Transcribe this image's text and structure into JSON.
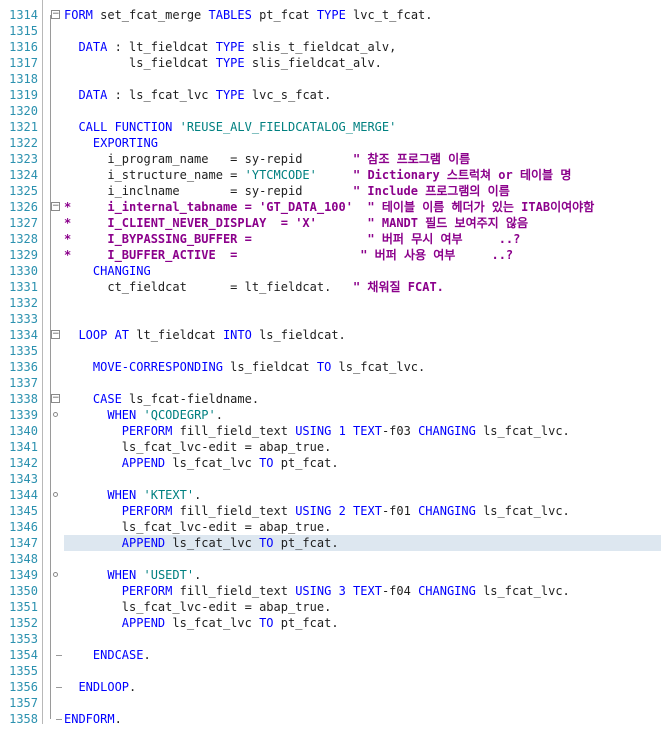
{
  "editor": {
    "highlighted_line": 1347,
    "lines": [
      {
        "no": "1314",
        "tokens": [
          [
            "kw",
            "FORM"
          ],
          [
            "id",
            " set_fcat_merge "
          ],
          [
            "kw",
            "TABLES"
          ],
          [
            "id",
            " pt_fcat "
          ],
          [
            "kw",
            "TYPE"
          ],
          [
            "id",
            " lvc_t_fcat."
          ]
        ]
      },
      {
        "no": "1315",
        "tokens": []
      },
      {
        "no": "1316",
        "tokens": [
          [
            "id",
            "  "
          ],
          [
            "kw",
            "DATA"
          ],
          [
            "id",
            " : lt_fieldcat "
          ],
          [
            "kw",
            "TYPE"
          ],
          [
            "id",
            " slis_t_fieldcat_alv,"
          ]
        ]
      },
      {
        "no": "1317",
        "tokens": [
          [
            "id",
            "         ls_fieldcat "
          ],
          [
            "kw",
            "TYPE"
          ],
          [
            "id",
            " slis_fieldcat_alv."
          ]
        ]
      },
      {
        "no": "1318",
        "tokens": []
      },
      {
        "no": "1319",
        "tokens": [
          [
            "id",
            "  "
          ],
          [
            "kw",
            "DATA"
          ],
          [
            "id",
            " : ls_fcat_lvc "
          ],
          [
            "kw",
            "TYPE"
          ],
          [
            "id",
            " lvc_s_fcat."
          ]
        ]
      },
      {
        "no": "1320",
        "tokens": []
      },
      {
        "no": "1321",
        "tokens": [
          [
            "id",
            "  "
          ],
          [
            "kw",
            "CALL FUNCTION"
          ],
          [
            "id",
            " "
          ],
          [
            "str",
            "'REUSE_ALV_FIELDCATALOG_MERGE'"
          ]
        ]
      },
      {
        "no": "1322",
        "tokens": [
          [
            "id",
            "    "
          ],
          [
            "kw",
            "EXPORTING"
          ]
        ]
      },
      {
        "no": "1323",
        "tokens": [
          [
            "id",
            "      i_program_name   = sy-repid       "
          ],
          [
            "cm",
            "\" 참조 프로그램 이름"
          ]
        ]
      },
      {
        "no": "1324",
        "tokens": [
          [
            "id",
            "      i_structure_name = "
          ],
          [
            "str",
            "'YTCMCODE'"
          ],
          [
            "id",
            "     "
          ],
          [
            "cm",
            "\" Dictionary 스트럭쳐 or 테이블 명"
          ]
        ]
      },
      {
        "no": "1325",
        "tokens": [
          [
            "id",
            "      i_inclname       = sy-repid       "
          ],
          [
            "cm",
            "\" Include 프로그램의 이름"
          ]
        ]
      },
      {
        "no": "1326",
        "tokens": [
          [
            "star",
            "*     i_internal_tabname = 'GT_DATA_100'  \" 테이블 이름 헤더가 있는 ITAB이여야함"
          ]
        ]
      },
      {
        "no": "1327",
        "tokens": [
          [
            "star",
            "*     I_CLIENT_NEVER_DISPLAY  = 'X'       \" MANDT 필드 보여주지 않음"
          ]
        ]
      },
      {
        "no": "1328",
        "tokens": [
          [
            "star",
            "*     I_BYPASSING_BUFFER =                \" 버퍼 무시 여부     ..?"
          ]
        ]
      },
      {
        "no": "1329",
        "tokens": [
          [
            "star",
            "*     I_BUFFER_ACTIVE  =                 \" 버퍼 사용 여부     ..?"
          ]
        ]
      },
      {
        "no": "1330",
        "tokens": [
          [
            "id",
            "    "
          ],
          [
            "kw",
            "CHANGING"
          ]
        ]
      },
      {
        "no": "1331",
        "tokens": [
          [
            "id",
            "      ct_fieldcat      = lt_fieldcat.   "
          ],
          [
            "cm",
            "\" 채워질 FCAT."
          ]
        ]
      },
      {
        "no": "1332",
        "tokens": []
      },
      {
        "no": "1333",
        "tokens": []
      },
      {
        "no": "1334",
        "tokens": [
          [
            "id",
            "  "
          ],
          [
            "kw",
            "LOOP AT"
          ],
          [
            "id",
            " lt_fieldcat "
          ],
          [
            "kw",
            "INTO"
          ],
          [
            "id",
            " ls_fieldcat."
          ]
        ]
      },
      {
        "no": "1335",
        "tokens": []
      },
      {
        "no": "1336",
        "tokens": [
          [
            "id",
            "    "
          ],
          [
            "kw",
            "MOVE-CORRESPONDING"
          ],
          [
            "id",
            " ls_fieldcat "
          ],
          [
            "kw",
            "TO"
          ],
          [
            "id",
            " ls_fcat_lvc."
          ]
        ]
      },
      {
        "no": "1337",
        "tokens": []
      },
      {
        "no": "1338",
        "tokens": [
          [
            "id",
            "    "
          ],
          [
            "kw",
            "CASE"
          ],
          [
            "id",
            " ls_fcat-fieldname."
          ]
        ]
      },
      {
        "no": "1339",
        "tokens": [
          [
            "id",
            "      "
          ],
          [
            "kw",
            "WHEN"
          ],
          [
            "id",
            " "
          ],
          [
            "str",
            "'QCODEGRP'"
          ],
          [
            "id",
            "."
          ]
        ]
      },
      {
        "no": "1340",
        "tokens": [
          [
            "id",
            "        "
          ],
          [
            "kw",
            "PERFORM"
          ],
          [
            "id",
            " fill_field_text "
          ],
          [
            "kw",
            "USING"
          ],
          [
            "id",
            " "
          ],
          [
            "num",
            "1"
          ],
          [
            "id",
            " "
          ],
          [
            "kw",
            "TEXT"
          ],
          [
            "id",
            "-f03 "
          ],
          [
            "kw",
            "CHANGING"
          ],
          [
            "id",
            " ls_fcat_lvc."
          ]
        ]
      },
      {
        "no": "1341",
        "tokens": [
          [
            "id",
            "        ls_fcat_lvc-edit = abap_true."
          ]
        ]
      },
      {
        "no": "1342",
        "tokens": [
          [
            "id",
            "        "
          ],
          [
            "kw",
            "APPEND"
          ],
          [
            "id",
            " ls_fcat_lvc "
          ],
          [
            "kw",
            "TO"
          ],
          [
            "id",
            " pt_fcat."
          ]
        ]
      },
      {
        "no": "1343",
        "tokens": []
      },
      {
        "no": "1344",
        "tokens": [
          [
            "id",
            "      "
          ],
          [
            "kw",
            "WHEN"
          ],
          [
            "id",
            " "
          ],
          [
            "str",
            "'KTEXT'"
          ],
          [
            "id",
            "."
          ]
        ]
      },
      {
        "no": "1345",
        "tokens": [
          [
            "id",
            "        "
          ],
          [
            "kw",
            "PERFORM"
          ],
          [
            "id",
            " fill_field_text "
          ],
          [
            "kw",
            "USING"
          ],
          [
            "id",
            " "
          ],
          [
            "num",
            "2"
          ],
          [
            "id",
            " "
          ],
          [
            "kw",
            "TEXT"
          ],
          [
            "id",
            "-f01 "
          ],
          [
            "kw",
            "CHANGING"
          ],
          [
            "id",
            " ls_fcat_lvc."
          ]
        ]
      },
      {
        "no": "1346",
        "tokens": [
          [
            "id",
            "        ls_fcat_lvc-edit = abap_true."
          ]
        ]
      },
      {
        "no": "1347",
        "tokens": [
          [
            "id",
            "        "
          ],
          [
            "kw",
            "APPEND"
          ],
          [
            "id",
            " ls_fcat_lvc "
          ],
          [
            "kw",
            "TO"
          ],
          [
            "id",
            " pt_fcat."
          ]
        ]
      },
      {
        "no": "1348",
        "tokens": []
      },
      {
        "no": "1349",
        "tokens": [
          [
            "id",
            "      "
          ],
          [
            "kw",
            "WHEN"
          ],
          [
            "id",
            " "
          ],
          [
            "str",
            "'USEDT'"
          ],
          [
            "id",
            "."
          ]
        ]
      },
      {
        "no": "1350",
        "tokens": [
          [
            "id",
            "        "
          ],
          [
            "kw",
            "PERFORM"
          ],
          [
            "id",
            " fill_field_text "
          ],
          [
            "kw",
            "USING"
          ],
          [
            "id",
            " "
          ],
          [
            "num",
            "3"
          ],
          [
            "id",
            " "
          ],
          [
            "kw",
            "TEXT"
          ],
          [
            "id",
            "-f04 "
          ],
          [
            "kw",
            "CHANGING"
          ],
          [
            "id",
            " ls_fcat_lvc."
          ]
        ]
      },
      {
        "no": "1351",
        "tokens": [
          [
            "id",
            "        ls_fcat_lvc-edit = abap_true."
          ]
        ]
      },
      {
        "no": "1352",
        "tokens": [
          [
            "id",
            "        "
          ],
          [
            "kw",
            "APPEND"
          ],
          [
            "id",
            " ls_fcat_lvc "
          ],
          [
            "kw",
            "TO"
          ],
          [
            "id",
            " pt_fcat."
          ]
        ]
      },
      {
        "no": "1353",
        "tokens": []
      },
      {
        "no": "1354",
        "tokens": [
          [
            "id",
            "    "
          ],
          [
            "kw",
            "ENDCASE"
          ],
          [
            "id",
            "."
          ]
        ]
      },
      {
        "no": "1355",
        "tokens": []
      },
      {
        "no": "1356",
        "tokens": [
          [
            "id",
            "  "
          ],
          [
            "kw",
            "ENDLOOP"
          ],
          [
            "id",
            "."
          ]
        ]
      },
      {
        "no": "1357",
        "tokens": []
      },
      {
        "no": "1358",
        "tokens": [
          [
            "kw",
            "ENDFORM"
          ],
          [
            "id",
            "."
          ]
        ]
      }
    ]
  }
}
